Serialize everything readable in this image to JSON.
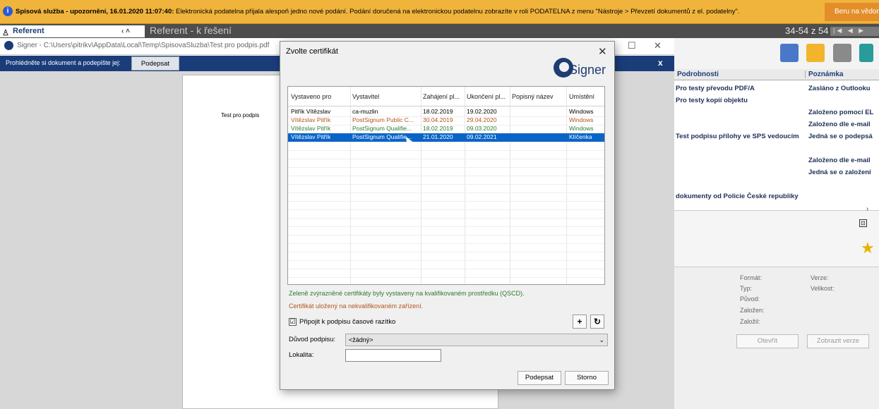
{
  "notification": {
    "icon": "info-icon",
    "title": "Spisová služba - upozornění, 16.01.2020 11:07:40:",
    "message": "Elektronická podatelna přijala alespoň jedno nové podání. Podání doručená na elektronickou podatelnu zobrazíte v roli PODATELNA z menu \"Nástroje > Převzetí dokumentů z el. podatelny\".",
    "button": "Beru na vědomí"
  },
  "tabbar": {
    "role": "Referent",
    "arrows": "‹ ˄",
    "title": "Referent - k řešení",
    "counter": "34-54 z 54",
    "nav": "|◀ ◀ ▶"
  },
  "signer": {
    "title": "Signer - C:\\Users\\pitrikv\\AppData\\Local\\Temp\\SpisovaSluzba\\Test pro podpis.pdf",
    "instruction": "Prohlédněte si dokument a podepište jej:",
    "sign_button": "Podepsat",
    "close": "x",
    "doc_text": "Test pro podpis"
  },
  "dialog": {
    "title": "Zvolte certifikát",
    "close": "✕",
    "logo_text": "Signer",
    "columns": [
      "Vystaveno pro",
      "Vystavitel",
      "Zahájení pl...",
      "Ukončení pl...",
      "Popisný název",
      "Umístění"
    ],
    "rows": [
      {
        "cells": [
          "Pitřík Vítězslav",
          "ca-muzlin",
          "18.02.2019",
          "19.02.2020",
          "",
          "Windows"
        ],
        "color": "#000000",
        "selected": false
      },
      {
        "cells": [
          "Vítězslav Pitřík",
          "PostSignum Public C...",
          "30.04.2019",
          "29.04.2020",
          "",
          "Windows"
        ],
        "color": "#b5541c",
        "selected": false
      },
      {
        "cells": [
          "Vítězslav Pitřík",
          "PostSignum Qualifie...",
          "18.02.2019",
          "09.03.2020",
          "",
          "Windows"
        ],
        "color": "#2d7a2d",
        "selected": false
      },
      {
        "cells": [
          "Vítězslav Pitřík",
          "PostSignum Qualifie...",
          "21.01.2020",
          "09.02.2021",
          "",
          "Klíčenka"
        ],
        "color": "#ffffff",
        "selected": true
      }
    ],
    "note_green": "Zeleně zvýrazněné certifikáty byly vystaveny na kvalifikovaném prostředku (QSCD).",
    "note_red": "Certifikát uložený na nekvalifikovaném zařízení.",
    "timestamp_label": "Připojit k podpisu časové razítko",
    "timestamp_checked": "☑",
    "add_button": "+",
    "refresh_button": "↻",
    "reason_label": "Důvod podpisu:",
    "reason_value": "<žádný>",
    "location_label": "Lokalita:",
    "location_value": "",
    "sign_button": "Podepsat",
    "cancel_button": "Storno"
  },
  "right_panel": {
    "columns": [
      "Podrobnosti",
      "Poznámka"
    ],
    "rows": [
      {
        "detail": "Pro testy převodu PDF/A",
        "note": "Zasláno z Outlooku"
      },
      {
        "detail": "Pro testy kopií objektu",
        "note": ""
      },
      {
        "detail": "",
        "note": "Založeno pomocí EL"
      },
      {
        "detail": "",
        "note": "Založeno dle e-mail"
      },
      {
        "detail": "Test podpisu přílohy ve SPS vedoucím",
        "note": "Jedná se o podepsá"
      },
      {
        "detail": "",
        "note": ""
      },
      {
        "detail": "",
        "note": "Založeno dle e-mail"
      },
      {
        "detail": "",
        "note": "Jedná se o založení"
      },
      {
        "detail": "",
        "note": ""
      },
      {
        "detail": "dokumenty od Policie České republiky",
        "note": ""
      }
    ],
    "meta": {
      "format": "Formát:",
      "version": "Verze:",
      "type": "Typ:",
      "size": "Velikost:",
      "origin": "Původ:",
      "created": "Založen:",
      "created_by": "Založil:",
      "open_button": "Otevřít",
      "show_version_button": "Zobrazit verze"
    }
  }
}
